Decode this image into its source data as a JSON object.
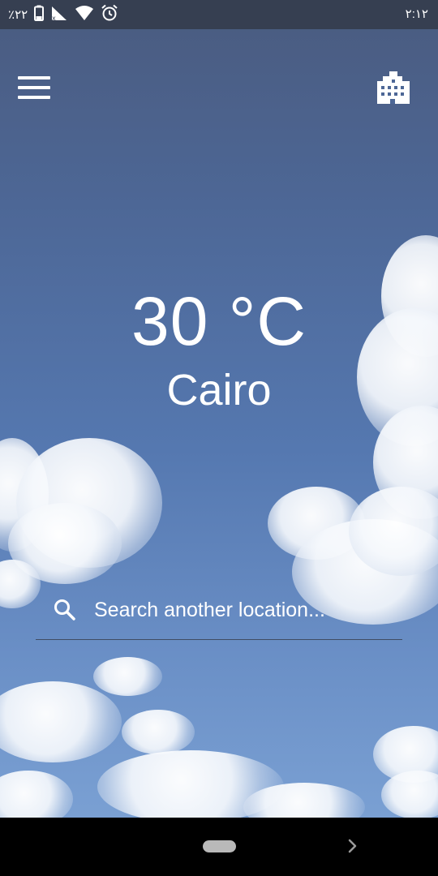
{
  "status_bar": {
    "battery_text": "٪٢٢",
    "time": "٢:١٢",
    "icons": [
      "battery-icon",
      "signal-icon",
      "wifi-icon",
      "alarm-icon"
    ]
  },
  "toolbar": {
    "menu_icon": "hamburger-menu-icon",
    "city_icon": "city-buildings-icon"
  },
  "weather": {
    "temperature": "30 °C",
    "city": "Cairo"
  },
  "search": {
    "placeholder": "Search another location...",
    "value": "",
    "icon": "search-icon"
  },
  "nav_bar": {
    "home_icon": "home-pill-icon",
    "back_icon": "chevron-right-icon"
  },
  "colors": {
    "status_bar": "#363f51",
    "sky_top": "#4a5b7f",
    "sky_bottom": "#7aa0d3",
    "text": "#ffffff"
  }
}
